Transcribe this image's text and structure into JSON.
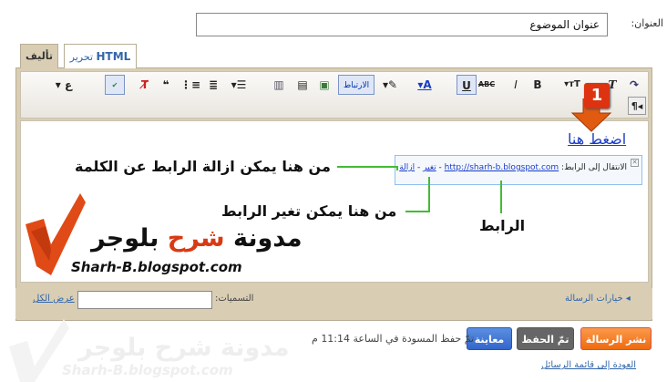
{
  "form": {
    "title_label": "العنوان:",
    "title_value": "عنوان الموضوع"
  },
  "tabs": {
    "compose": "تأليف",
    "html_html": "HTML",
    "html_word": "تحرير"
  },
  "toolbar": {
    "link_label": "الارتباط",
    "step_badge": "1"
  },
  "editor": {
    "link_text": "اضغط هنا"
  },
  "popup": {
    "goto_label": "الانتقال إلى الرابط:",
    "url": "http://sharh-b.blogspot.com",
    "sep": "-",
    "change": "تغير",
    "remove": "ازالة"
  },
  "annotations": {
    "remove_note": "من هنا يمكن ازالة الرابط عن الكلمة",
    "change_note": "من هنا يمكن تغير الرابط",
    "link_note": "الرابط"
  },
  "logo": {
    "word1": "مدونة",
    "word2": "شرح",
    "word3": "بلوجر",
    "url": "Sharh-B.blogspot.com"
  },
  "status": {
    "labels_label": "التسميات:",
    "show_all": "عرض الكل",
    "post_options": "خيارات الرسالة"
  },
  "actions": {
    "publish": "نشر الرسالة",
    "saved": "تمّ الحفظ",
    "preview": "معاينة",
    "save_status": "تمّ حفظ المسودة في الساعة 11:14 م",
    "back_link": "العودة إلى قائمة الرسائل"
  },
  "colors": {
    "accent": "#f06a10",
    "link": "#1a3cc9",
    "guide": "#44bb33",
    "badge": "#dd3311"
  }
}
